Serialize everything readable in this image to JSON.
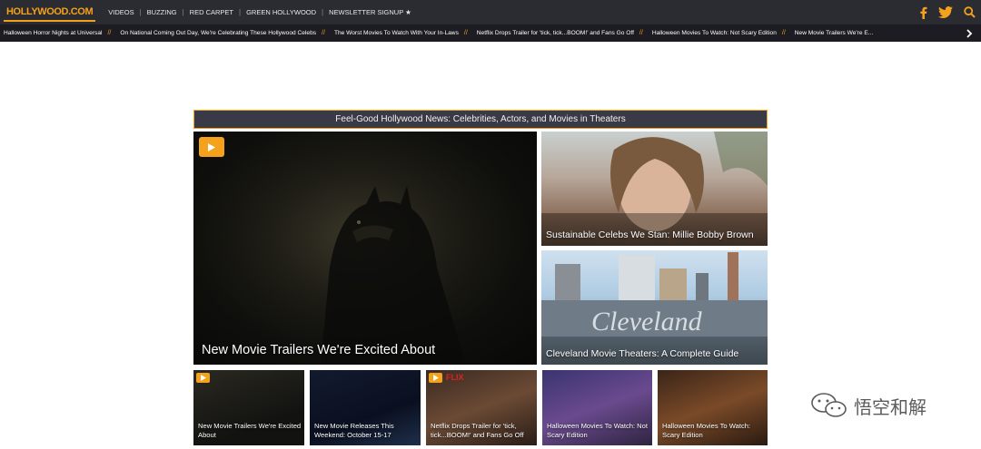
{
  "logo": "HOLLYWOOD.COM",
  "nav": {
    "links": [
      "VIDEOS",
      "BUZZING",
      "RED CARPET",
      "GREEN HOLLYWOOD",
      "NEWSLETTER SIGNUP ★"
    ]
  },
  "ticker": [
    "Halloween Horror Nights at Universal",
    "On National Coming Out Day, We're Celebrating These Hollywood Celebs",
    "The Worst Movies To Watch With Your In-Laws",
    "Netflix Drops Trailer for 'tick, tick...BOOM!' and Fans Go Off",
    "Halloween Movies To Watch: Not Scary Edition",
    "New Movie Trailers We're E..."
  ],
  "section_title": "Feel-Good Hollywood News: Celebrities, Actors, and Movies in Theaters",
  "hero": {
    "title": "New Movie Trailers We're Excited About"
  },
  "side_cards": [
    {
      "title": "Sustainable Celebs We Stan: Millie Bobby Brown"
    },
    {
      "title": "Cleveland Movie Theaters: A Complete Guide"
    }
  ],
  "small_cards": [
    {
      "title": "New Movie Trailers We're Excited About"
    },
    {
      "title": "New Movie Releases This Weekend: October 15-17"
    },
    {
      "title": "Netflix Drops Trailer for 'tick, tick...BOOM!' and Fans Go Off"
    },
    {
      "title": "Halloween Movies To Watch: Not Scary Edition"
    },
    {
      "title": "Halloween Movies To Watch: Scary Edition"
    }
  ],
  "netflix_label": "FLIX",
  "cleveland_sign": "Cleveland",
  "watermark": "悟空和解",
  "colors": {
    "accent": "#f4a11c",
    "nav_bg": "#2b2b32",
    "ticker_bg": "#1c1c22"
  },
  "icons": [
    "facebook-icon",
    "twitter-icon",
    "search-icon",
    "chevron-right-icon",
    "play-icon",
    "wechat-icon"
  ]
}
